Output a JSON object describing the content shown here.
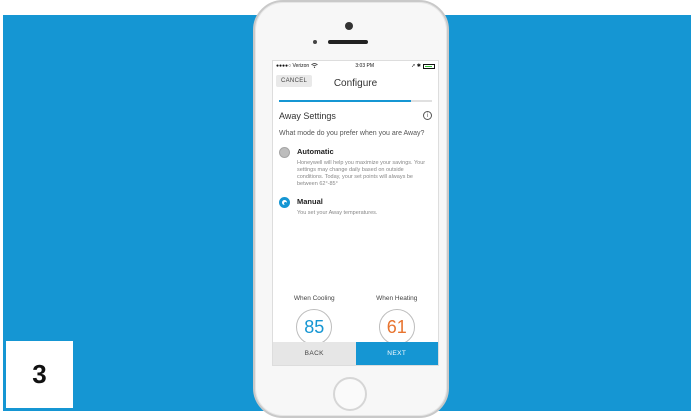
{
  "step": {
    "number": "3"
  },
  "status_bar": {
    "carrier": "●●●●○ Verizon",
    "wifi_icon": "wifi-icon",
    "time": "3:03 PM",
    "right_icons": "➚ ✱"
  },
  "nav": {
    "cancel_label": "CANCEL",
    "title": "Configure"
  },
  "progress": {
    "fraction": 0.86
  },
  "section": {
    "title": "Away Settings",
    "info_icon": "i"
  },
  "question": "What mode do you prefer when you are Away?",
  "options": [
    {
      "label": "Automatic",
      "selected": false,
      "description": "Honeywell will help you maximize your savings. Your settings may change daily based on outside conditions. Today, your set points will always be between 62°-85°"
    },
    {
      "label": "Manual",
      "selected": true,
      "description": "You set your Away temperatures."
    }
  ],
  "temps": {
    "cooling_label": "When Cooling",
    "cooling_value": "85",
    "heating_label": "When Heating",
    "heating_value": "61"
  },
  "footer": {
    "back_label": "BACK",
    "next_label": "NEXT"
  },
  "colors": {
    "background": "#1596d3",
    "accent": "#1596d3",
    "heat": "#e8742f"
  }
}
